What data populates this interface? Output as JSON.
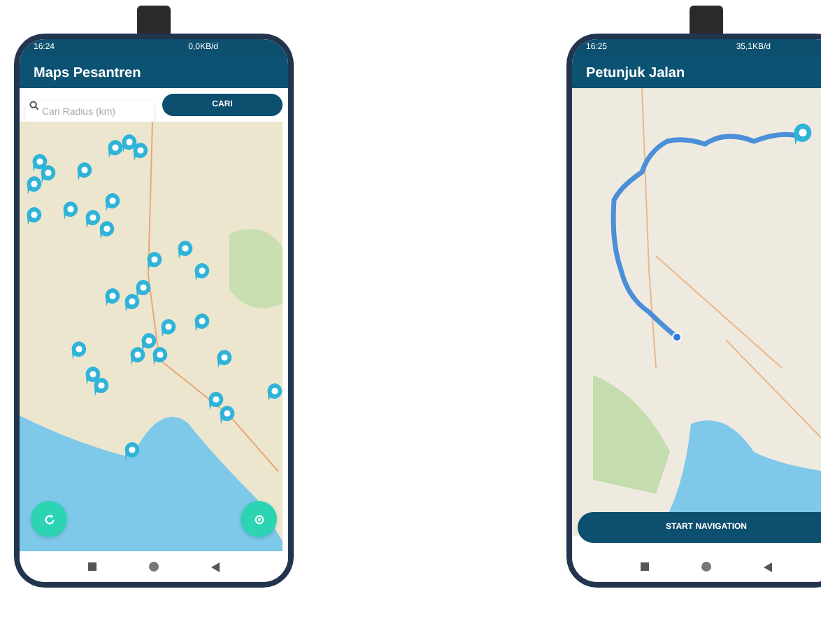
{
  "phones": [
    {
      "status_bar": {
        "time": "16:24",
        "speed": "0,0KB/d"
      },
      "app_bar": {
        "title": "Maps Pesantren"
      },
      "search": {
        "placeholder": "Cari Radius (km)",
        "button": "CARI"
      },
      "map": {
        "kind": "markers"
      }
    },
    {
      "status_bar": {
        "time": "16:25",
        "speed": "35,1KB/d"
      },
      "app_bar": {
        "title": "Petunjuk Jalan"
      },
      "map": {
        "kind": "route"
      },
      "action_button": "START NAVIGATION"
    }
  ]
}
